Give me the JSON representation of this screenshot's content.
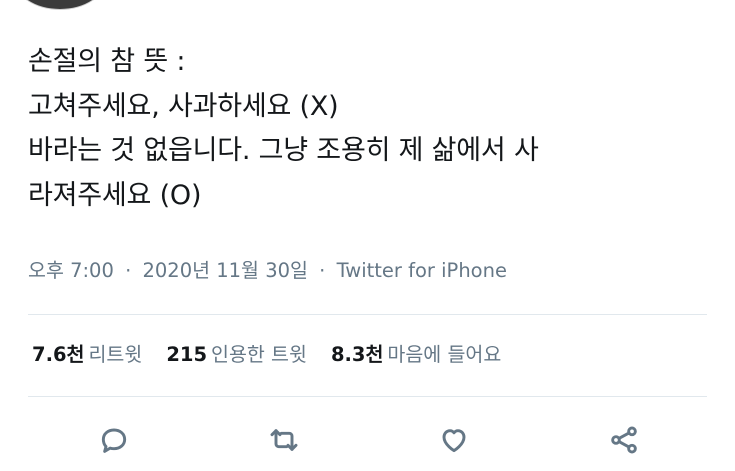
{
  "tweet": {
    "lines": [
      "손절의 참 뜻 :",
      "고쳐주세요, 사과하세요 (X)",
      "바라는 것 없읍니다. 그냥 조용히 제 삶에서 사",
      "라져주세요 (O)"
    ]
  },
  "meta": {
    "time": "오후 7:00",
    "date": "2020년 11월 30일",
    "separator": "·",
    "source": "Twitter for iPhone"
  },
  "stats": {
    "retweets": {
      "count": "7.6천",
      "label": "리트윗"
    },
    "quotes": {
      "count": "215",
      "label": "인용한 트윗"
    },
    "likes": {
      "count": "8.3천",
      "label": "마음에 들어요"
    }
  },
  "actions": {
    "reply_icon": "reply-icon",
    "retweet_icon": "retweet-icon",
    "like_icon": "heart-icon",
    "share_icon": "share-icon"
  },
  "colors": {
    "text": "#14171a",
    "secondary": "#657786",
    "divider": "#e1e8ed"
  }
}
